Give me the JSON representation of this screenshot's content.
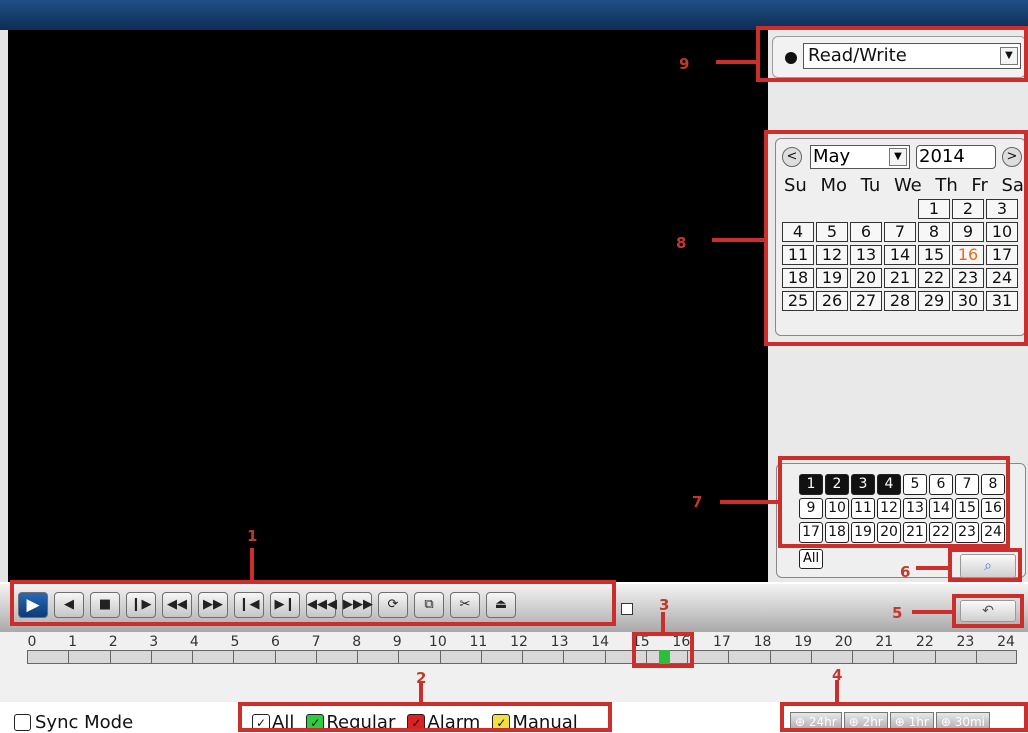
{
  "mode": {
    "selected": "Read/Write"
  },
  "calendar": {
    "month": "May",
    "year": "2014",
    "prev": "<",
    "next": ">",
    "dows": [
      "Su",
      "Mo",
      "Tu",
      "We",
      "Th",
      "Fr",
      "Sa"
    ],
    "leading_blanks": 4,
    "days": [
      "1",
      "2",
      "3",
      "4",
      "5",
      "6",
      "7",
      "8",
      "9",
      "10",
      "11",
      "12",
      "13",
      "14",
      "15",
      "16",
      "17",
      "18",
      "19",
      "20",
      "21",
      "22",
      "23",
      "24",
      "25",
      "26",
      "27",
      "28",
      "29",
      "30",
      "31"
    ],
    "recorded_day": "16"
  },
  "channels": {
    "items": [
      "1",
      "2",
      "3",
      "4",
      "5",
      "6",
      "7",
      "8",
      "9",
      "10",
      "11",
      "12",
      "13",
      "14",
      "15",
      "16",
      "17",
      "18",
      "19",
      "20",
      "21",
      "22",
      "23",
      "24"
    ],
    "selected": [
      "1",
      "2",
      "3",
      "4"
    ],
    "all_label": "All"
  },
  "controls": {
    "buttons": [
      {
        "name": "play-button",
        "glyph": "▶"
      },
      {
        "name": "reverse-play-button",
        "glyph": "◀"
      },
      {
        "name": "stop-button",
        "glyph": "■"
      },
      {
        "name": "pause-button",
        "glyph": "❙▶"
      },
      {
        "name": "slow-button",
        "glyph": "◀◀"
      },
      {
        "name": "fast-button",
        "glyph": "▶▶"
      },
      {
        "name": "prev-frame-button",
        "glyph": "❙◀"
      },
      {
        "name": "next-frame-button",
        "glyph": "▶❙"
      },
      {
        "name": "prev-file-button",
        "glyph": "◀◀◀"
      },
      {
        "name": "next-file-button",
        "glyph": "▶▶▶"
      },
      {
        "name": "loop-button",
        "glyph": "⟳"
      },
      {
        "name": "fullscreen-button",
        "glyph": "⧉"
      },
      {
        "name": "clip-button",
        "glyph": "✂"
      },
      {
        "name": "backup-button",
        "glyph": "⏏"
      }
    ]
  },
  "timeline": {
    "hours": [
      "0",
      "1",
      "2",
      "3",
      "4",
      "5",
      "6",
      "7",
      "8",
      "9",
      "10",
      "11",
      "12",
      "13",
      "14",
      "15",
      "16",
      "17",
      "18",
      "19",
      "20",
      "21",
      "22",
      "23",
      "24"
    ]
  },
  "footer": {
    "sync_mode": "Sync Mode",
    "legend": [
      {
        "label": "All",
        "color": "#ffffff"
      },
      {
        "label": "Regular",
        "color": "#2ecc40"
      },
      {
        "label": "Alarm",
        "color": "#e02020"
      },
      {
        "label": "Manual",
        "color": "#f0e040"
      }
    ],
    "zoom": [
      "24hr",
      "2hr",
      "1hr",
      "30mi"
    ]
  },
  "annotations": [
    "1",
    "2",
    "3",
    "4",
    "5",
    "6",
    "7",
    "8",
    "9"
  ],
  "colors": {
    "annotation": "#cc2e2e",
    "record_green": "#2ebd3a",
    "record_day": "#e86a1a"
  },
  "icons": {
    "search": "search-icon",
    "undo": "undo-icon",
    "zoom": "zoom-icon"
  }
}
